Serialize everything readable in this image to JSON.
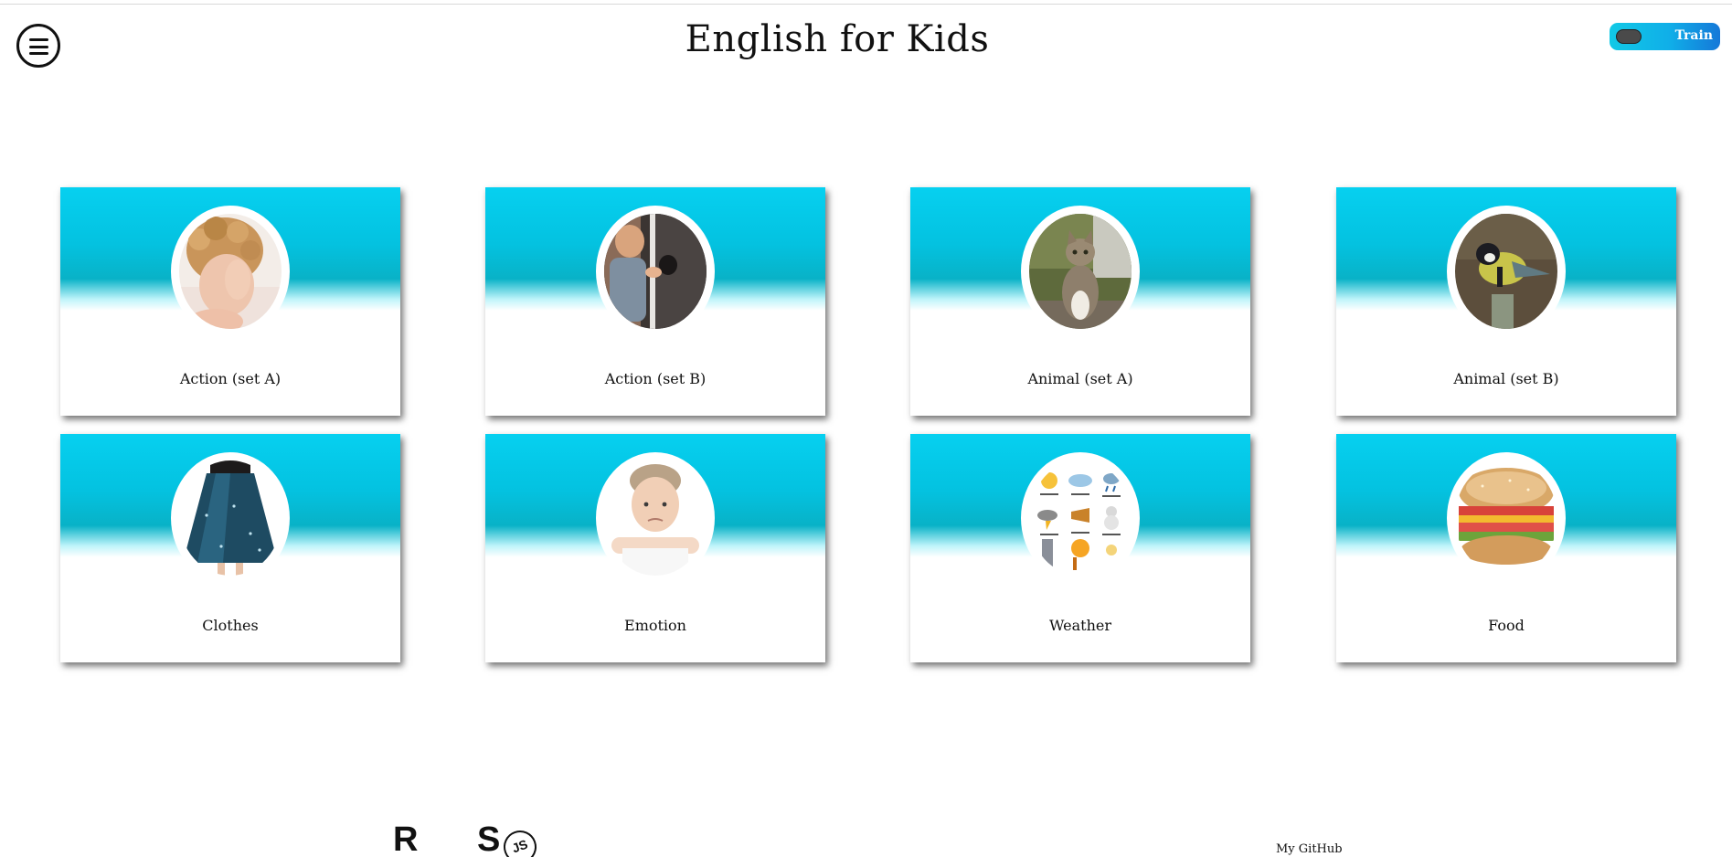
{
  "header": {
    "title": "English for Kids",
    "menu_icon": "hamburger-menu-icon",
    "mode_toggle": {
      "label": "Train",
      "state": "train"
    }
  },
  "categories": [
    {
      "label": "Action (set A)",
      "image": "child-covering-face"
    },
    {
      "label": "Action (set B)",
      "image": "child-opening-door"
    },
    {
      "label": "Animal (set A)",
      "image": "cat"
    },
    {
      "label": "Animal (set B)",
      "image": "bird"
    },
    {
      "label": "Clothes",
      "image": "skirt"
    },
    {
      "label": "Emotion",
      "image": "sad-boy"
    },
    {
      "label": "Weather",
      "image": "weather-icons"
    },
    {
      "label": "Food",
      "image": "sandwich"
    }
  ],
  "footer": {
    "logo_r": "R",
    "logo_s": "S",
    "logo_js": "JS",
    "github_label": "My GitHub"
  },
  "colors": {
    "card_top": "#06d0f0",
    "card_band": "#08b2c7",
    "toggle_start": "#11c9e6",
    "toggle_end": "#1578d8",
    "page_bg": "#ffffff"
  }
}
